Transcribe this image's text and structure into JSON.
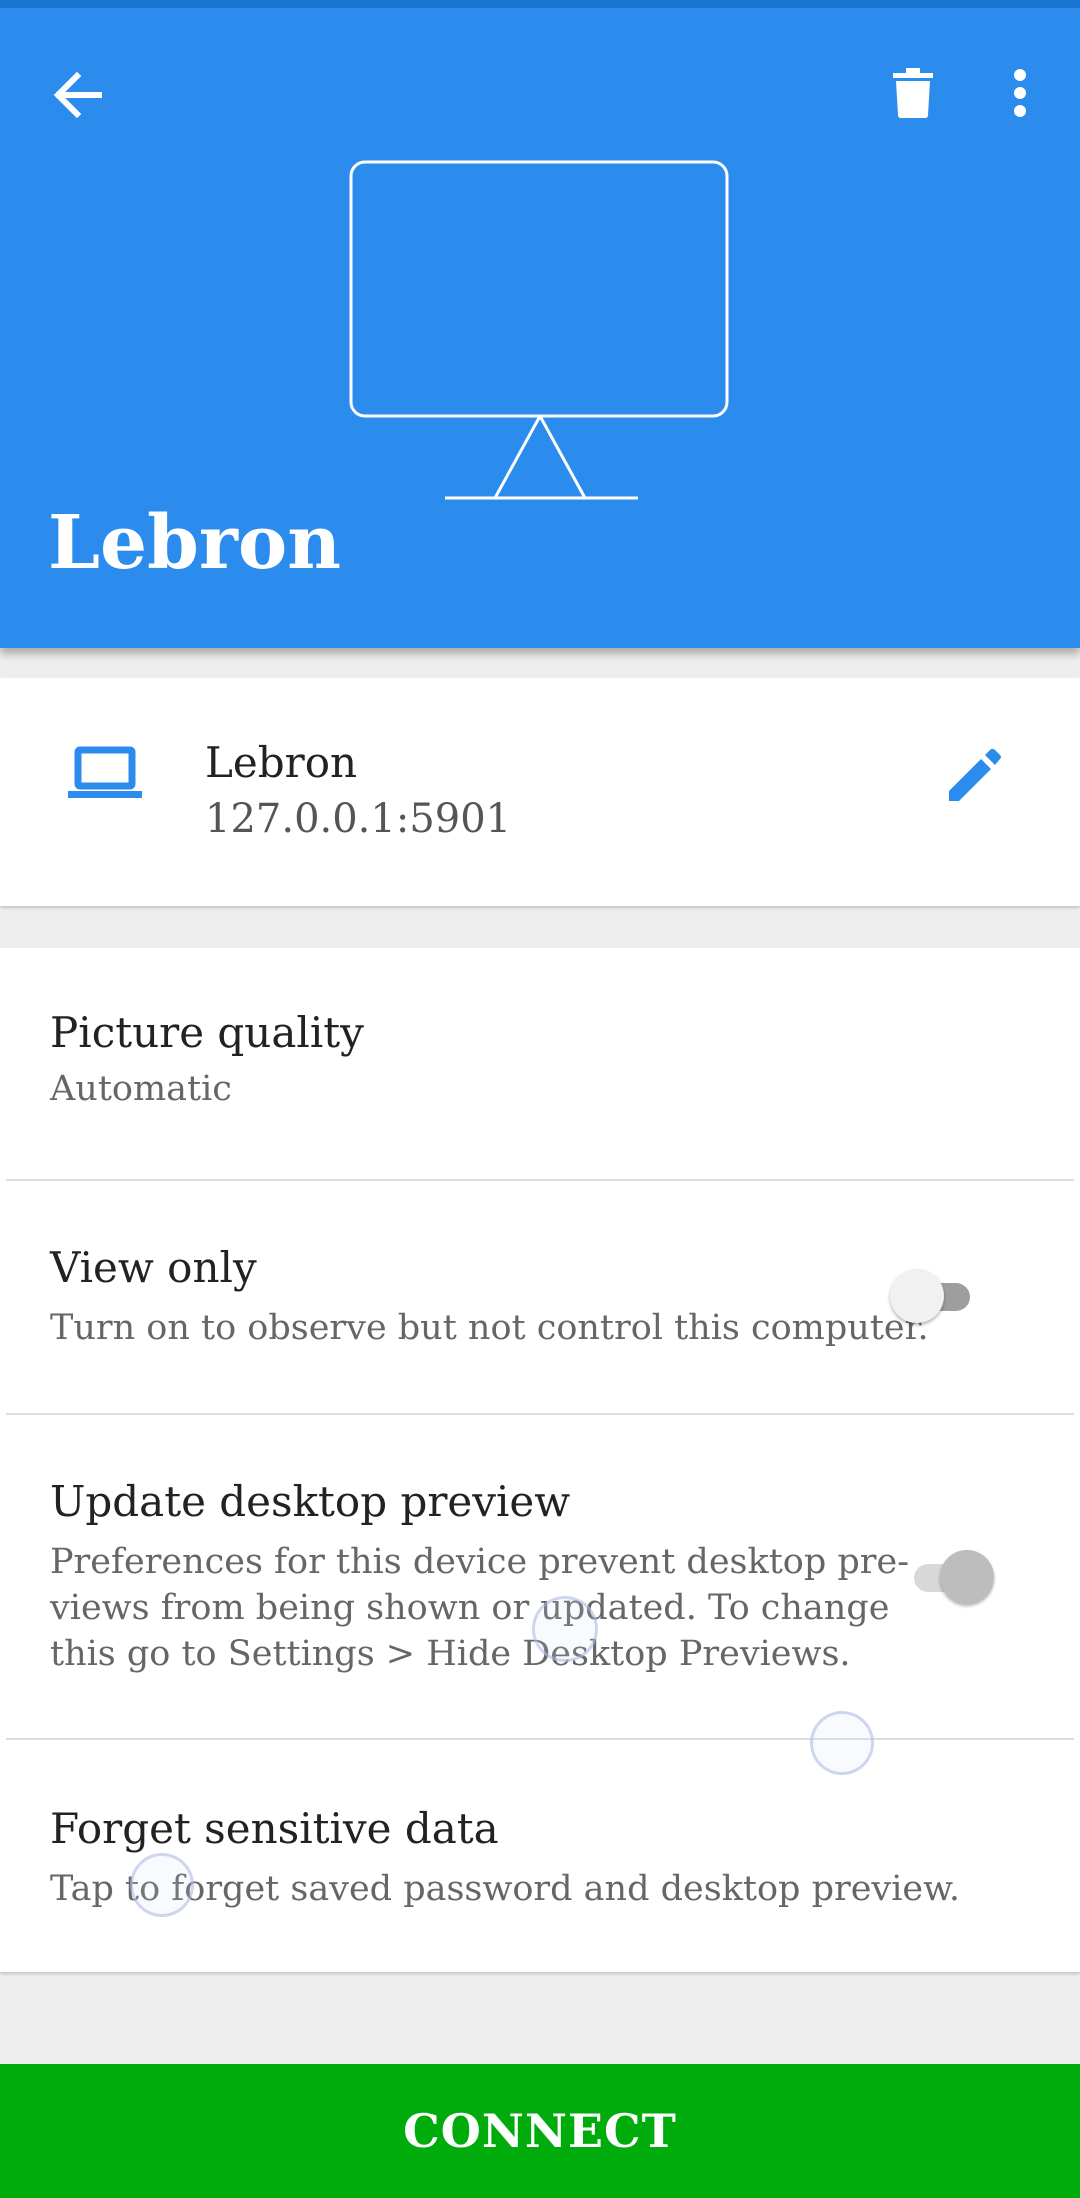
{
  "header": {
    "title": "Lebron",
    "color": "#2b8ced"
  },
  "host": {
    "name": "Lebron",
    "address": "127.0.0.1:5901",
    "icon": "laptop-icon"
  },
  "settings": [
    {
      "title": "Picture quality",
      "subtitle": "Automatic"
    },
    {
      "title": "View only",
      "subtitle": "Turn on to observe but not control this computer.",
      "toggle_on": false
    },
    {
      "title": "Update desktop preview",
      "subtitle_lines": [
        "Preferences for this device prevent desktop pre-",
        "views from being shown or updated. To change",
        "this go to Settings > Hide Desktop Previews."
      ],
      "toggle_on": true,
      "toggle_disabled": true
    },
    {
      "title": "Forget sensitive data",
      "subtitle": "Tap to forget saved password and desktop preview."
    }
  ],
  "connect_label": "CONNECT",
  "connect_color": "#00ab0c",
  "icons": [
    "arrow-back-icon",
    "trash-icon",
    "more-vert-icon",
    "monitor-icon",
    "laptop-icon",
    "pencil-icon"
  ]
}
